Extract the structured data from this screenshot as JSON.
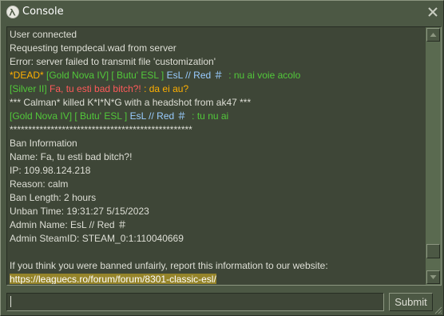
{
  "window": {
    "title": "Console"
  },
  "icons": {
    "logo": "half-life-lambda-icon",
    "close": "close-icon",
    "resize": "resize-grip-icon"
  },
  "colors": {
    "window_bg": "#4c5844",
    "console_bg": "#3e4637",
    "text": "#dedfd6",
    "yellow": "#ffb000",
    "green": "#52c83a",
    "red": "#ff5a5a",
    "blue": "#99ccff",
    "highlight": "#95842a"
  },
  "log": [
    {
      "segments": [
        {
          "text": "User connected",
          "color": "white"
        }
      ]
    },
    {
      "segments": [
        {
          "text": "Requesting tempdecal.wad from server",
          "color": "white"
        }
      ]
    },
    {
      "segments": [
        {
          "text": "Error: server failed to transmit file 'customization'",
          "color": "white"
        }
      ]
    },
    {
      "segments": [
        {
          "text": "*DEAD* ",
          "color": "yellow"
        },
        {
          "text": "[Gold Nova IV] [ Butu' ESL ] ",
          "color": "green"
        },
        {
          "text": "EsL // Red ＃",
          "color": "blue"
        },
        {
          "text": "  : nu ai voie acolo",
          "color": "green"
        }
      ]
    },
    {
      "segments": [
        {
          "text": "[Silver II] ",
          "color": "green"
        },
        {
          "text": "Fa, tu esti bad bitch?!",
          "color": "red"
        },
        {
          "text": " : da ei au?",
          "color": "yellow"
        }
      ]
    },
    {
      "segments": [
        {
          "text": "*** Calman* killed K*I*N*G with a headshot from ak47 ***",
          "color": "white"
        }
      ]
    },
    {
      "segments": [
        {
          "text": "[Gold Nova IV] [ Butu' ESL ] ",
          "color": "green"
        },
        {
          "text": "EsL // Red ＃",
          "color": "blue"
        },
        {
          "text": "  : tu nu ai",
          "color": "green"
        }
      ]
    },
    {
      "segments": [
        {
          "text": "*************************************************",
          "color": "white"
        }
      ]
    },
    {
      "segments": [
        {
          "text": "Ban Information",
          "color": "white"
        }
      ]
    },
    {
      "segments": [
        {
          "text": "Name: Fa, tu esti bad bitch?!",
          "color": "white"
        }
      ]
    },
    {
      "segments": [
        {
          "text": "IP: 109.98.124.218",
          "color": "white"
        }
      ]
    },
    {
      "segments": [
        {
          "text": "Reason: calm",
          "color": "white"
        }
      ]
    },
    {
      "segments": [
        {
          "text": "Ban Length: 2 hours",
          "color": "white"
        }
      ]
    },
    {
      "segments": [
        {
          "text": "Unban Time: 19:31:27 5/15/2023",
          "color": "white"
        }
      ]
    },
    {
      "segments": [
        {
          "text": "Admin Name: EsL // Red ＃",
          "color": "white"
        }
      ]
    },
    {
      "segments": [
        {
          "text": "Admin SteamID: STEAM_0:1:110040669",
          "color": "white"
        }
      ]
    },
    {
      "segments": [
        {
          "text": "",
          "color": "white"
        }
      ]
    },
    {
      "segments": [
        {
          "text": "If you think you were banned unfairly, report this information to our website:",
          "color": "white"
        }
      ]
    },
    {
      "segments": [
        {
          "text": "https://leaguecs.ro/forum/forum/8301-classic-esl/",
          "color": "white",
          "highlight": true
        }
      ]
    }
  ],
  "input": {
    "value": "",
    "placeholder": ""
  },
  "submit": {
    "label": "Submit"
  },
  "scroll": {
    "position": 0.95
  }
}
